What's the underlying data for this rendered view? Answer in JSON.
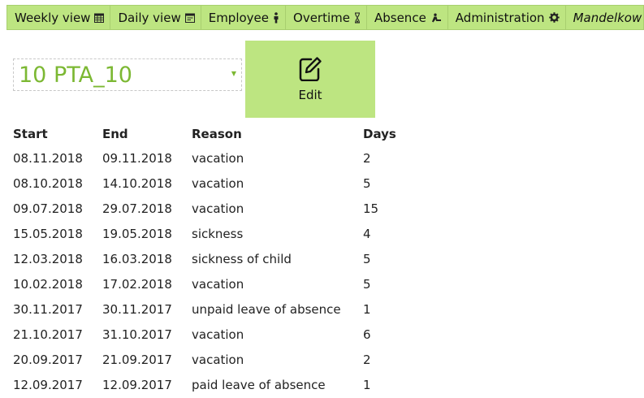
{
  "nav": {
    "weekly_view": "Weekly view",
    "daily_view": "Daily view",
    "employee": "Employee",
    "overtime": "Overtime",
    "absence": "Absence",
    "administration": "Administration",
    "user": "Mandelkow"
  },
  "employee_select": {
    "selected": "10 PTA_10"
  },
  "edit_button": {
    "label": "Edit"
  },
  "table": {
    "headers": {
      "start": "Start",
      "end": "End",
      "reason": "Reason",
      "days": "Days"
    },
    "rows": [
      {
        "start": "08.11.2018",
        "end": "09.11.2018",
        "reason": "vacation",
        "days": "2"
      },
      {
        "start": "08.10.2018",
        "end": "14.10.2018",
        "reason": "vacation",
        "days": "5"
      },
      {
        "start": "09.07.2018",
        "end": "29.07.2018",
        "reason": "vacation",
        "days": "15"
      },
      {
        "start": "15.05.2018",
        "end": "19.05.2018",
        "reason": "sickness",
        "days": "4"
      },
      {
        "start": "12.03.2018",
        "end": "16.03.2018",
        "reason": "sickness of child",
        "days": "5"
      },
      {
        "start": "10.02.2018",
        "end": "17.02.2018",
        "reason": "vacation",
        "days": "5"
      },
      {
        "start": "30.11.2017",
        "end": "30.11.2017",
        "reason": "unpaid leave of absence",
        "days": "1"
      },
      {
        "start": "21.10.2017",
        "end": "31.10.2017",
        "reason": "vacation",
        "days": "6"
      },
      {
        "start": "20.09.2017",
        "end": "21.09.2017",
        "reason": "vacation",
        "days": "2"
      },
      {
        "start": "12.09.2017",
        "end": "12.09.2017",
        "reason": "paid leave of absence",
        "days": "1"
      }
    ]
  },
  "colors": {
    "nav_bg": "#bde581",
    "accent": "#7cb833"
  },
  "icons": {
    "weekly_view": "calendar-icon",
    "daily_view": "daily-calendar-icon",
    "employee": "person-icon",
    "overtime": "hourglass-icon",
    "absence": "absence-icon",
    "administration": "gear-icon",
    "user": "user-icon",
    "edit": "edit-icon"
  }
}
